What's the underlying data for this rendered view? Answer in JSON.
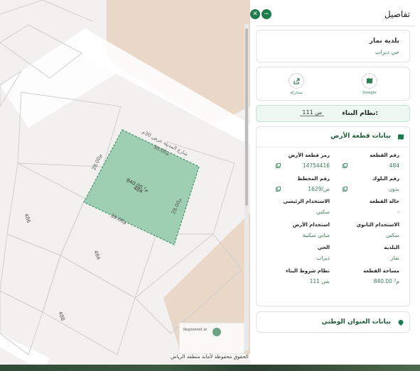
{
  "panel": {
    "title": "تفاصيل",
    "close_symbol": "✕",
    "minimize_symbol": "−"
  },
  "municipality": {
    "name": "بلدية نمار",
    "district": "حي ديراب"
  },
  "actions": [
    {
      "label": "Google",
      "icon": "map-icon"
    },
    {
      "label": "مشاركة",
      "icon": "share-icon"
    }
  ],
  "building_system": {
    "label": "نظام البناء:",
    "value": "س 111"
  },
  "land_section": {
    "title": "بيانات قطعة الأرض",
    "fields": [
      {
        "label": "رقم القطعة",
        "value": "484",
        "copy": true
      },
      {
        "label": "رمز قطعة الأرض",
        "value": "14754416",
        "copy": true
      },
      {
        "label": "رقم البلوك",
        "value": "بدون",
        "copy": true
      },
      {
        "label": "رقم المخطط",
        "value": "1629/ص",
        "copy": true
      },
      {
        "label": "حالة القطعة",
        "value": "-",
        "copy": false
      },
      {
        "label": "الاستخدام الرئيسي",
        "value": "سكني",
        "copy": false
      },
      {
        "label": "الاستخدام الثانوي",
        "value": "سكني",
        "copy": false
      },
      {
        "label": "استخدام الأرض",
        "value": "مباني سكنية",
        "copy": false
      },
      {
        "label": "البلدية",
        "value": "نمار",
        "copy": false
      },
      {
        "label": "الحي",
        "value": "ديراب",
        "copy": false
      },
      {
        "label": "مساحة القطعة",
        "value": "840.00 م²",
        "copy": false
      },
      {
        "label": "نظام شروط البناء",
        "value": "بس 111",
        "copy": false
      }
    ]
  },
  "address_section": {
    "title": "بيانات العنوان الوطني"
  },
  "map": {
    "street_name": "شارع المدينة عرض 30م",
    "selected_area": "840.00 م²",
    "selected_number": "484",
    "dims": [
      "30.00م",
      "28.00م",
      "30.00م",
      "28.00م"
    ],
    "lot_numbers": [
      "486",
      "484",
      "488"
    ],
    "footer": "جميع الحقوق محفوظة لأمانة منطقة الرياض",
    "watermark": "Registered at"
  },
  "colors": {
    "accent": "#1f7a4d",
    "parcel_fill": "#9fcfb3",
    "parcel_stroke": "#3f8f63",
    "sand": "#e9d7c7"
  }
}
